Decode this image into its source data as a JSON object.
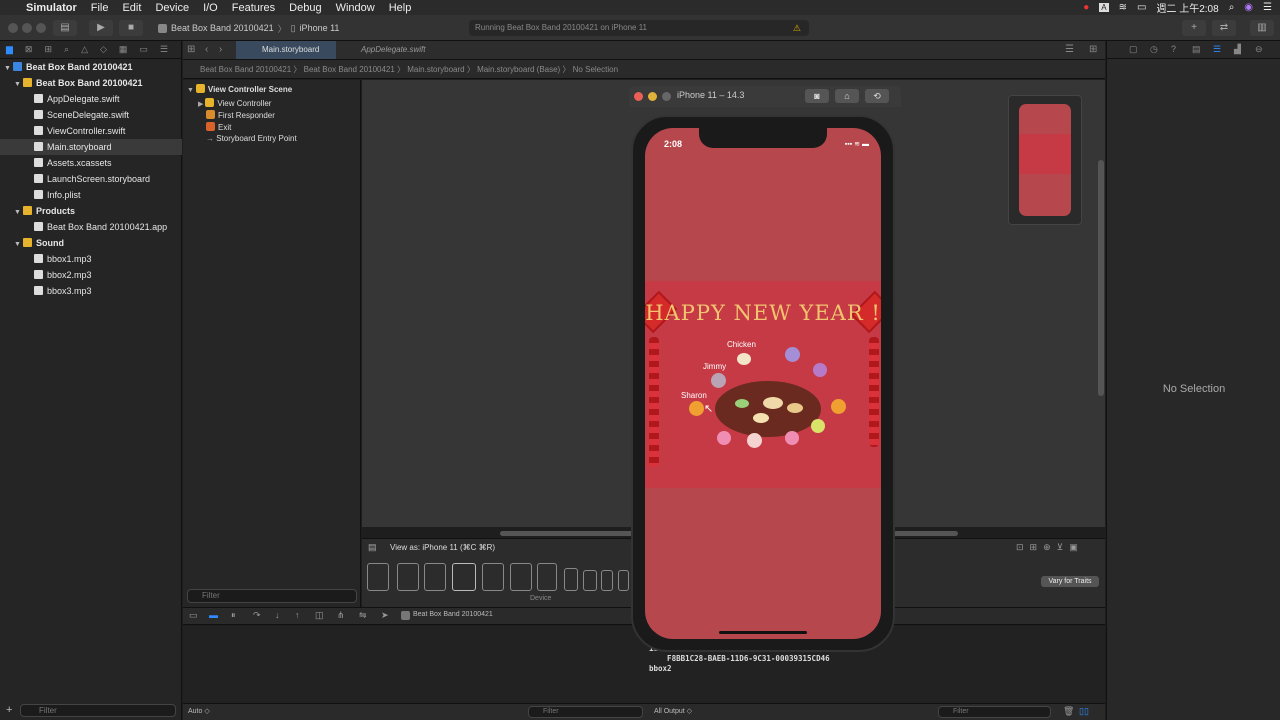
{
  "menubar": {
    "apple": "",
    "app_name": "Simulator",
    "items": [
      "File",
      "Edit",
      "Device",
      "I/O",
      "Features",
      "Debug",
      "Window",
      "Help"
    ],
    "clock": "週二 上午2:08"
  },
  "toolbar": {
    "scheme_project": "Beat Box Band 20100421",
    "scheme_device": "iPhone 11",
    "activity": "Running Beat Box Band 20100421 on iPhone 11",
    "warning": "⚠"
  },
  "navigator": {
    "items": [
      {
        "label": "Beat Box Band 20100421",
        "kind": "project"
      },
      {
        "label": "Beat Box Band 20100421",
        "kind": "folder"
      },
      {
        "label": "AppDelegate.swift",
        "kind": "file"
      },
      {
        "label": "SceneDelegate.swift",
        "kind": "file"
      },
      {
        "label": "ViewController.swift",
        "kind": "file"
      },
      {
        "label": "Main.storyboard",
        "kind": "file",
        "selected": true
      },
      {
        "label": "Assets.xcassets",
        "kind": "file"
      },
      {
        "label": "LaunchScreen.storyboard",
        "kind": "file"
      },
      {
        "label": "Info.plist",
        "kind": "file"
      },
      {
        "label": "Products",
        "kind": "folder"
      },
      {
        "label": "Beat Box Band 20100421.app",
        "kind": "file"
      },
      {
        "label": "Sound",
        "kind": "folder"
      },
      {
        "label": "bbox1.mp3",
        "kind": "file"
      },
      {
        "label": "bbox2.mp3",
        "kind": "file"
      },
      {
        "label": "bbox3.mp3",
        "kind": "file"
      }
    ],
    "filter_placeholder": "Filter"
  },
  "editor": {
    "tabs": [
      "Main.storyboard",
      "AppDelegate.swift"
    ],
    "jumpbar": "Beat Box Band 20100421  〉 Beat Box Band 20100421  〉 Main.storyboard  〉 Main.storyboard (Base)  〉 No Selection",
    "outline": [
      "View Controller Scene",
      "View Controller",
      "First Responder",
      "Exit",
      "Storyboard Entry Point"
    ],
    "outline_filter": "Filter",
    "view_as": "View as: iPhone 11 (⌘C ⌘R)",
    "device_label": "Device",
    "vary_button": "Vary for Traits"
  },
  "debug": {
    "target": "Beat Box Band 20100421",
    "console_lines": "100421[63709:2826783] [plugin]\nied for id <CFUUID 0x600002aab760>\n    F8BB1C28-BAEB-11D6-9C31-00039315CD46\nbbox2",
    "auto_label": "Auto ◇",
    "filter": "Filter",
    "output_label": "All Output ◇"
  },
  "inspector": {
    "no_selection": "No Selection"
  },
  "simulator": {
    "title": "iPhone 11 – 14.3",
    "time": "2:08",
    "art_title": "HAPPY NEW YEAR !",
    "names": [
      "Chicken",
      "Jimmy",
      "Sharon"
    ],
    "colors": {
      "screen_bg": "#b5474d",
      "art_bg": "#c63a46",
      "title": "#f1c470"
    }
  }
}
